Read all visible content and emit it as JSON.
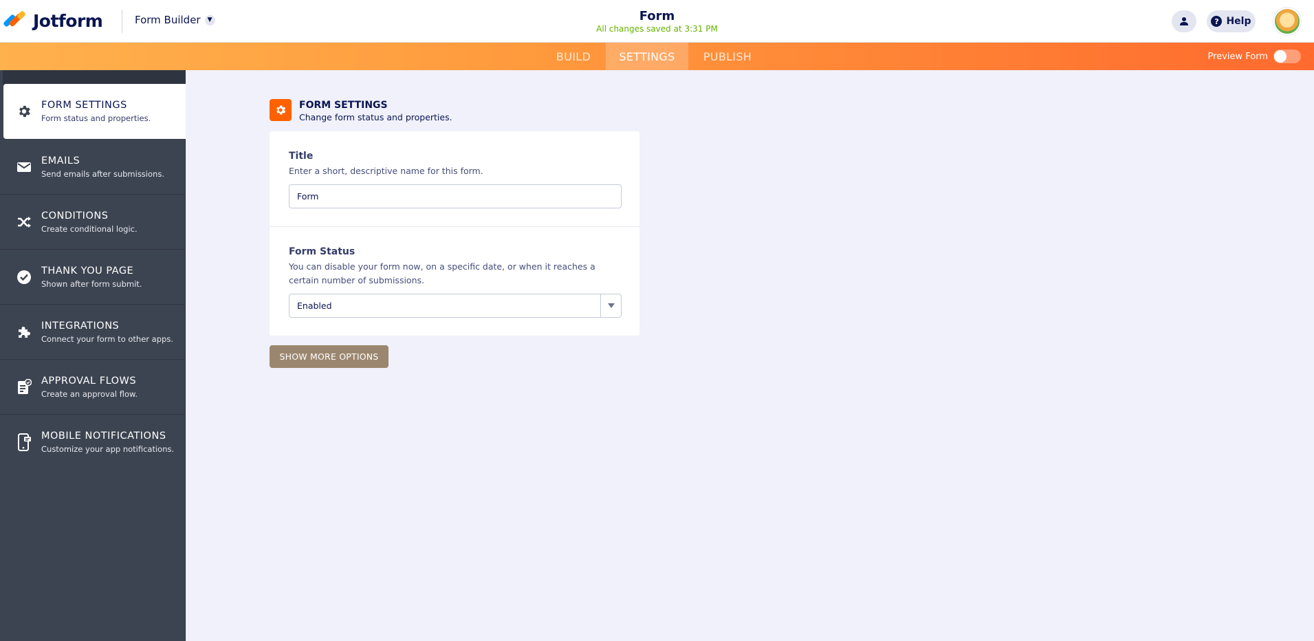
{
  "header": {
    "logo_text": "Jotform",
    "builder_label": "Form Builder",
    "form_title": "Form",
    "saved_status": "All changes saved at 3:31 PM",
    "help_label": "Help"
  },
  "nav": {
    "tabs": [
      {
        "label": "BUILD",
        "active": false
      },
      {
        "label": "SETTINGS",
        "active": true
      },
      {
        "label": "PUBLISH",
        "active": false
      }
    ],
    "preview_label": "Preview Form",
    "preview_enabled": false
  },
  "sidebar": {
    "items": [
      {
        "title": "FORM SETTINGS",
        "desc": "Form status and properties.",
        "icon": "gear-icon",
        "active": true
      },
      {
        "title": "EMAILS",
        "desc": "Send emails after submissions.",
        "icon": "envelope-icon",
        "active": false
      },
      {
        "title": "CONDITIONS",
        "desc": "Create conditional logic.",
        "icon": "shuffle-icon",
        "active": false
      },
      {
        "title": "THANK YOU PAGE",
        "desc": "Shown after form submit.",
        "icon": "check-circle-icon",
        "active": false
      },
      {
        "title": "INTEGRATIONS",
        "desc": "Connect your form to other apps.",
        "icon": "puzzle-icon",
        "active": false
      },
      {
        "title": "APPROVAL FLOWS",
        "desc": "Create an approval flow.",
        "icon": "approval-icon",
        "active": false
      },
      {
        "title": "MOBILE NOTIFICATIONS",
        "desc": "Customize your app notifications.",
        "icon": "mobile-notification-icon",
        "active": false
      }
    ]
  },
  "main": {
    "section_title": "FORM SETTINGS",
    "section_desc": "Change form status and properties.",
    "title_field": {
      "label": "Title",
      "help": "Enter a short, descriptive name for this form.",
      "value": "Form"
    },
    "status_field": {
      "label": "Form Status",
      "help": "You can disable your form now, on a specific date, or when it reaches a certain number of submissions.",
      "value": "Enabled"
    },
    "more_button": "SHOW MORE OPTIONS"
  },
  "colors": {
    "accent": "#ff6100",
    "navy": "#0a1551",
    "sidebar_bg": "#3d4451",
    "saved_green": "#64b200",
    "more_button_bg": "#9b8770"
  }
}
